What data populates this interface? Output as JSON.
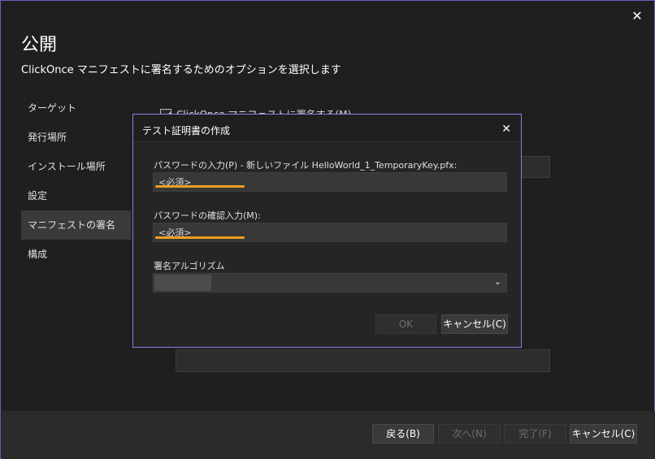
{
  "window": {
    "title": "公開",
    "subtitle": "ClickOnce マニフェストに署名するためのオプションを選択します",
    "close_glyph": "✕"
  },
  "nav": {
    "items": [
      {
        "label": "ターゲット"
      },
      {
        "label": "発行場所"
      },
      {
        "label": "インストール場所"
      },
      {
        "label": "設定"
      },
      {
        "label": "マニフェストの署名",
        "selected": true
      },
      {
        "label": "構成"
      }
    ]
  },
  "background": {
    "checkbox_label": "ClickOnce マニフェストに署名する(M)"
  },
  "footer": {
    "back_label": "戻る(B)",
    "next_label": "次へ(N)",
    "finish_label": "完了(F)",
    "cancel_label": "キャンセル(C)"
  },
  "dialog": {
    "title": "テスト証明書の作成",
    "close_glyph": "✕",
    "password_label": "パスワードの入力(P) - 新しいファイル HelloWorld_1_TemporaryKey.pfx:",
    "password_placeholder": "<必須>",
    "confirm_label": "パスワードの確認入力(M):",
    "confirm_placeholder": "<必須>",
    "algorithm_label": "署名アルゴリズム",
    "algorithm_value": "",
    "dropdown_glyph": "⌄",
    "ok_label": "OK",
    "cancel_label": "キャンセル(C)"
  },
  "colors": {
    "accent_border": "#8d7fe0",
    "highlight_underline": "#f0a020"
  }
}
